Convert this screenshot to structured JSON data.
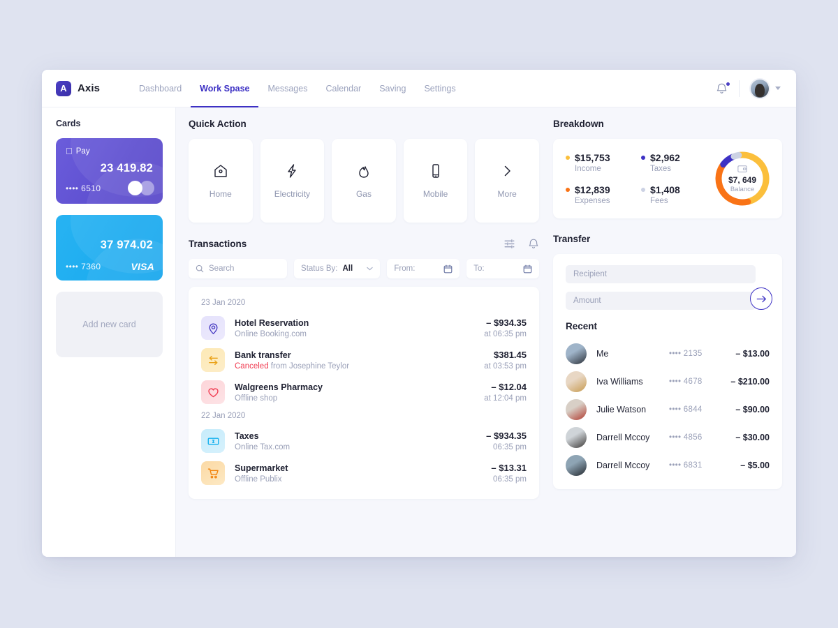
{
  "app": {
    "brand_initial": "A",
    "brand_name": "Axis"
  },
  "nav": {
    "links": [
      {
        "label": "Dashboard",
        "active": false
      },
      {
        "label": "Work Spase",
        "active": true
      },
      {
        "label": "Messages",
        "active": false
      },
      {
        "label": "Calendar",
        "active": false
      },
      {
        "label": "Saving",
        "active": false
      },
      {
        "label": "Settings",
        "active": false
      }
    ]
  },
  "sidebar": {
    "title": "Cards",
    "cards": [
      {
        "brand_label": "Pay",
        "amount": "23 419.82",
        "masked": "•••• 6510",
        "logo": "mastercard",
        "theme": "purple"
      },
      {
        "brand_label": "",
        "amount": "37 974.02",
        "masked": "•••• 7360",
        "logo": "VISA",
        "theme": "blue"
      }
    ],
    "add_card_label": "Add new card"
  },
  "quick_action": {
    "title": "Quick Action",
    "tiles": [
      {
        "label": "Home",
        "icon": "home-icon"
      },
      {
        "label": "Electricity",
        "icon": "bolt-icon"
      },
      {
        "label": "Gas",
        "icon": "flame-icon"
      },
      {
        "label": "Mobile",
        "icon": "phone-icon"
      },
      {
        "label": "More",
        "icon": "chevron-right-icon"
      }
    ]
  },
  "transactions": {
    "title": "Transactions",
    "filters": {
      "search_placeholder": "Search",
      "status_label": "Status By:",
      "status_value": "All",
      "from_label": "From:",
      "to_label": "To:"
    },
    "groups": [
      {
        "date": "23 Jan 2020",
        "items": [
          {
            "title": "Hotel Reservation",
            "sub": "Online Booking.com",
            "sub_status": "",
            "amount": "– $934.35",
            "time": "at 06:35 pm",
            "icon": "location-pin-icon",
            "tone": "i-purple"
          },
          {
            "title": "Bank transfer",
            "sub": "from Josephine Teylor",
            "sub_status": "Canceled",
            "amount": "$381.45",
            "time": "at 03:53 pm",
            "icon": "transfer-arrows-icon",
            "tone": "i-yellow"
          },
          {
            "title": "Walgreens Pharmacy",
            "sub": "Offline shop",
            "sub_status": "",
            "amount": "– $12.04",
            "time": "at 12:04 pm",
            "icon": "heart-icon",
            "tone": "i-red"
          }
        ]
      },
      {
        "date": "22 Jan 2020",
        "items": [
          {
            "title": "Taxes",
            "sub": "Online Tax.com",
            "sub_status": "",
            "amount": "– $934.35",
            "time": "06:35 pm",
            "icon": "banknote-icon",
            "tone": "i-cyan"
          },
          {
            "title": "Supermarket",
            "sub": "Offline Publix",
            "sub_status": "",
            "amount": "– $13.31",
            "time": "06:35 pm",
            "icon": "cart-icon",
            "tone": "i-orange"
          }
        ]
      }
    ]
  },
  "breakdown": {
    "title": "Breakdown",
    "items": [
      {
        "value": "$15,753",
        "label": "Income",
        "color": "#fbbf3c"
      },
      {
        "value": "$2,962",
        "label": "Taxes",
        "color": "#3d31c4"
      },
      {
        "value": "$12,839",
        "label": "Expenses",
        "color": "#f97316"
      },
      {
        "value": "$1,408",
        "label": "Fees",
        "color": "#ccd2e4"
      }
    ],
    "balance_value": "$7, 649",
    "balance_label": "Balance"
  },
  "chart_data": {
    "type": "pie",
    "title": "Breakdown",
    "categories": [
      "Income",
      "Expenses",
      "Taxes",
      "Fees"
    ],
    "values": [
      15753,
      12839,
      2962,
      1408
    ],
    "colors": [
      "#fbbf3c",
      "#f97316",
      "#3d31c4",
      "#ccd2e4"
    ],
    "center_label": "Balance",
    "center_value": "$7, 649",
    "legend": "left",
    "donut": true
  },
  "transfer": {
    "title": "Transfer",
    "recipient_placeholder": "Recipient",
    "amount_placeholder": "Amount",
    "send_icon": "arrow-right-icon",
    "recent_title": "Recent",
    "recent": [
      {
        "name": "Me",
        "card": "•••• 2135",
        "amount": "– $13.00",
        "av1": "#9fb4c9",
        "av2": "#2b3038"
      },
      {
        "name": "Iva Williams",
        "card": "•••• 4678",
        "amount": "– $210.00",
        "av1": "#e8d7c4",
        "av2": "#c79a4f"
      },
      {
        "name": "Julie Watson",
        "card": "•••• 6844",
        "amount": "– $90.00",
        "av1": "#d8cfc6",
        "av2": "#b03a2e"
      },
      {
        "name": "Darrell Mccoy",
        "card": "•••• 4856",
        "amount": "– $30.00",
        "av1": "#cfd4d8",
        "av2": "#3d3a38"
      },
      {
        "name": "Darrell Mccoy",
        "card": "•••• 6831",
        "amount": "– $5.00",
        "av1": "#8ea4b4",
        "av2": "#23282e"
      }
    ]
  }
}
